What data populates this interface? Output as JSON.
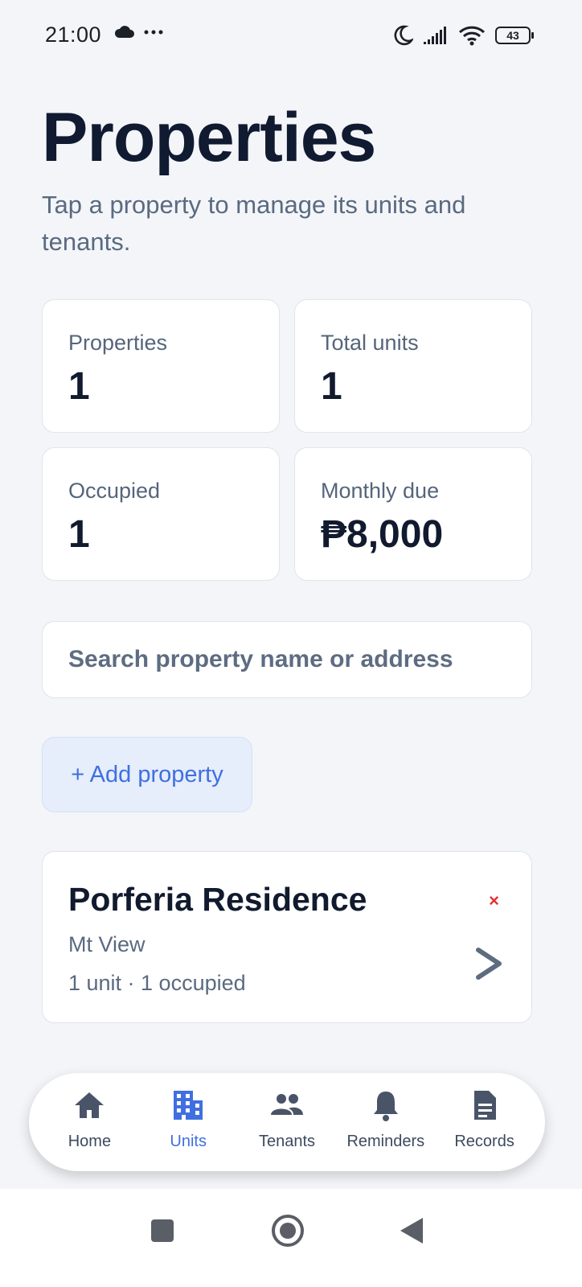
{
  "status_bar": {
    "time": "21:00",
    "battery": "43",
    "icons": [
      "cloud-icon",
      "more-dots-icon",
      "moon-icon",
      "signal-icon",
      "wifi-icon",
      "battery-icon"
    ]
  },
  "header": {
    "title": "Properties",
    "subtitle": "Tap a property to manage its units and tenants."
  },
  "stats": [
    {
      "label": "Properties",
      "value": "1"
    },
    {
      "label": "Total units",
      "value": "1"
    },
    {
      "label": "Occupied",
      "value": "1"
    },
    {
      "label": "Monthly due",
      "value": "₱8,000"
    }
  ],
  "search": {
    "placeholder": "Search property name or address",
    "value": ""
  },
  "add_button": {
    "label": "+ Add property"
  },
  "properties": [
    {
      "name": "Porferia Residence",
      "address": "Mt View",
      "meta": "1 unit · 1 occupied",
      "delete_symbol": "×"
    }
  ],
  "bottom_nav": {
    "items": [
      {
        "label": "Home",
        "icon": "home-icon",
        "active": false
      },
      {
        "label": "Units",
        "icon": "building-icon",
        "active": true
      },
      {
        "label": "Tenants",
        "icon": "people-icon",
        "active": false
      },
      {
        "label": "Reminders",
        "icon": "bell-icon",
        "active": false
      },
      {
        "label": "Records",
        "icon": "document-icon",
        "active": false
      }
    ]
  },
  "colors": {
    "background": "#f3f5f9",
    "accent": "#3f6fe0",
    "accent_bg": "#e6edfb",
    "danger": "#e5322e",
    "text_primary": "#111a2e",
    "text_secondary": "#5a6a80",
    "nav_icon": "#4a5468"
  }
}
